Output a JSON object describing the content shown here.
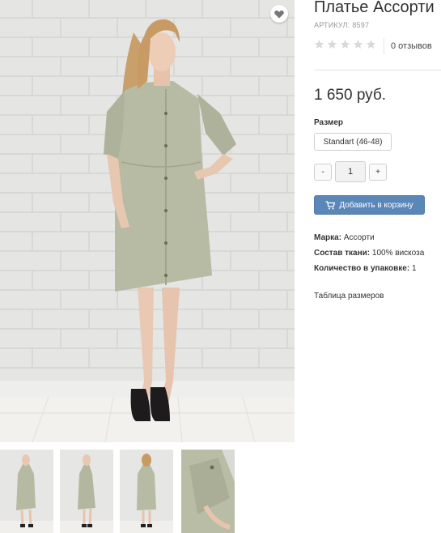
{
  "product": {
    "title": "Платье Ассорти",
    "sku_label": "АРТИКУЛ:",
    "sku_value": "8597",
    "rating": {
      "filled": 0,
      "total": 5
    },
    "reviews": "0 отзывов",
    "price": "1 650 руб."
  },
  "options": {
    "size_label": "Размер",
    "size_value": "Standart (46-48)",
    "qty_minus": "-",
    "qty_value": "1",
    "qty_plus": "+"
  },
  "cart": {
    "label": "Добавить в корзину",
    "icon": "cart-icon"
  },
  "specs": [
    {
      "key": "Марка:",
      "value": "Ассорти"
    },
    {
      "key": "Состав ткани:",
      "value": "100% вискоза"
    },
    {
      "key": "Количество в упаковке:",
      "value": "1"
    }
  ],
  "size_table_link": "Таблица размеров",
  "colors": {
    "accent": "#5b87b8",
    "dress": "#b5b9a2",
    "wall": "#e4e4e2"
  },
  "thumbnails": [
    "front-view",
    "side-view",
    "back-view",
    "sleeve-detail"
  ]
}
